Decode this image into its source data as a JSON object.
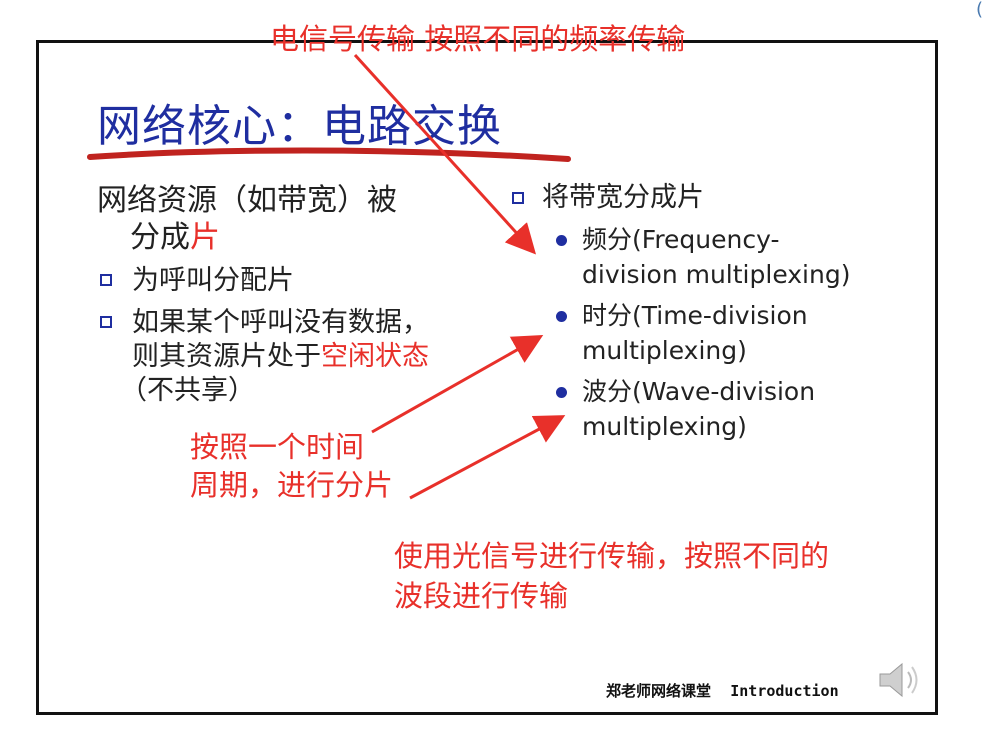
{
  "slide": {
    "title": "网络核心：电路交换",
    "left": {
      "para_line1": "网络资源（如带宽）被",
      "para_line2_plain": "分成",
      "para_line2_red": "片",
      "bullet1": "为呼叫分配片",
      "bullet2_line1": "如果某个呼叫没有数据，",
      "bullet2_line2_plain": "则其资源片处于",
      "bullet2_line2_red": "空闲状态",
      "bullet2_line3": "（不共享）"
    },
    "right": {
      "heading": "将带宽分成片",
      "items": [
        {
          "line1": "频分(Frequency-",
          "line2": "division multiplexing)"
        },
        {
          "line1": "时分(Time-division",
          "line2": "multiplexing)"
        },
        {
          "line1": "波分(Wave-division",
          "line2": "multiplexing)"
        }
      ]
    },
    "annotations": {
      "top": "电信号传输 按照不同的频率传输",
      "middle_line1": "按照一个时间",
      "middle_line2": "周期，进行分片",
      "bottom_line1": "使用光信号进行传输，按照不同的",
      "bottom_line2": "波段进行传输"
    },
    "footer": {
      "brand": "郑老师网络课堂",
      "section": "Introduction"
    },
    "colors": {
      "title": "#1f2ea0",
      "annotation": "#e8302a",
      "bullet": "#1f2ea0",
      "text": "#222222"
    },
    "icons": [
      "checkbox-bullet-icon",
      "dot-bullet-icon",
      "speaker-icon",
      "arrow-icon"
    ]
  }
}
